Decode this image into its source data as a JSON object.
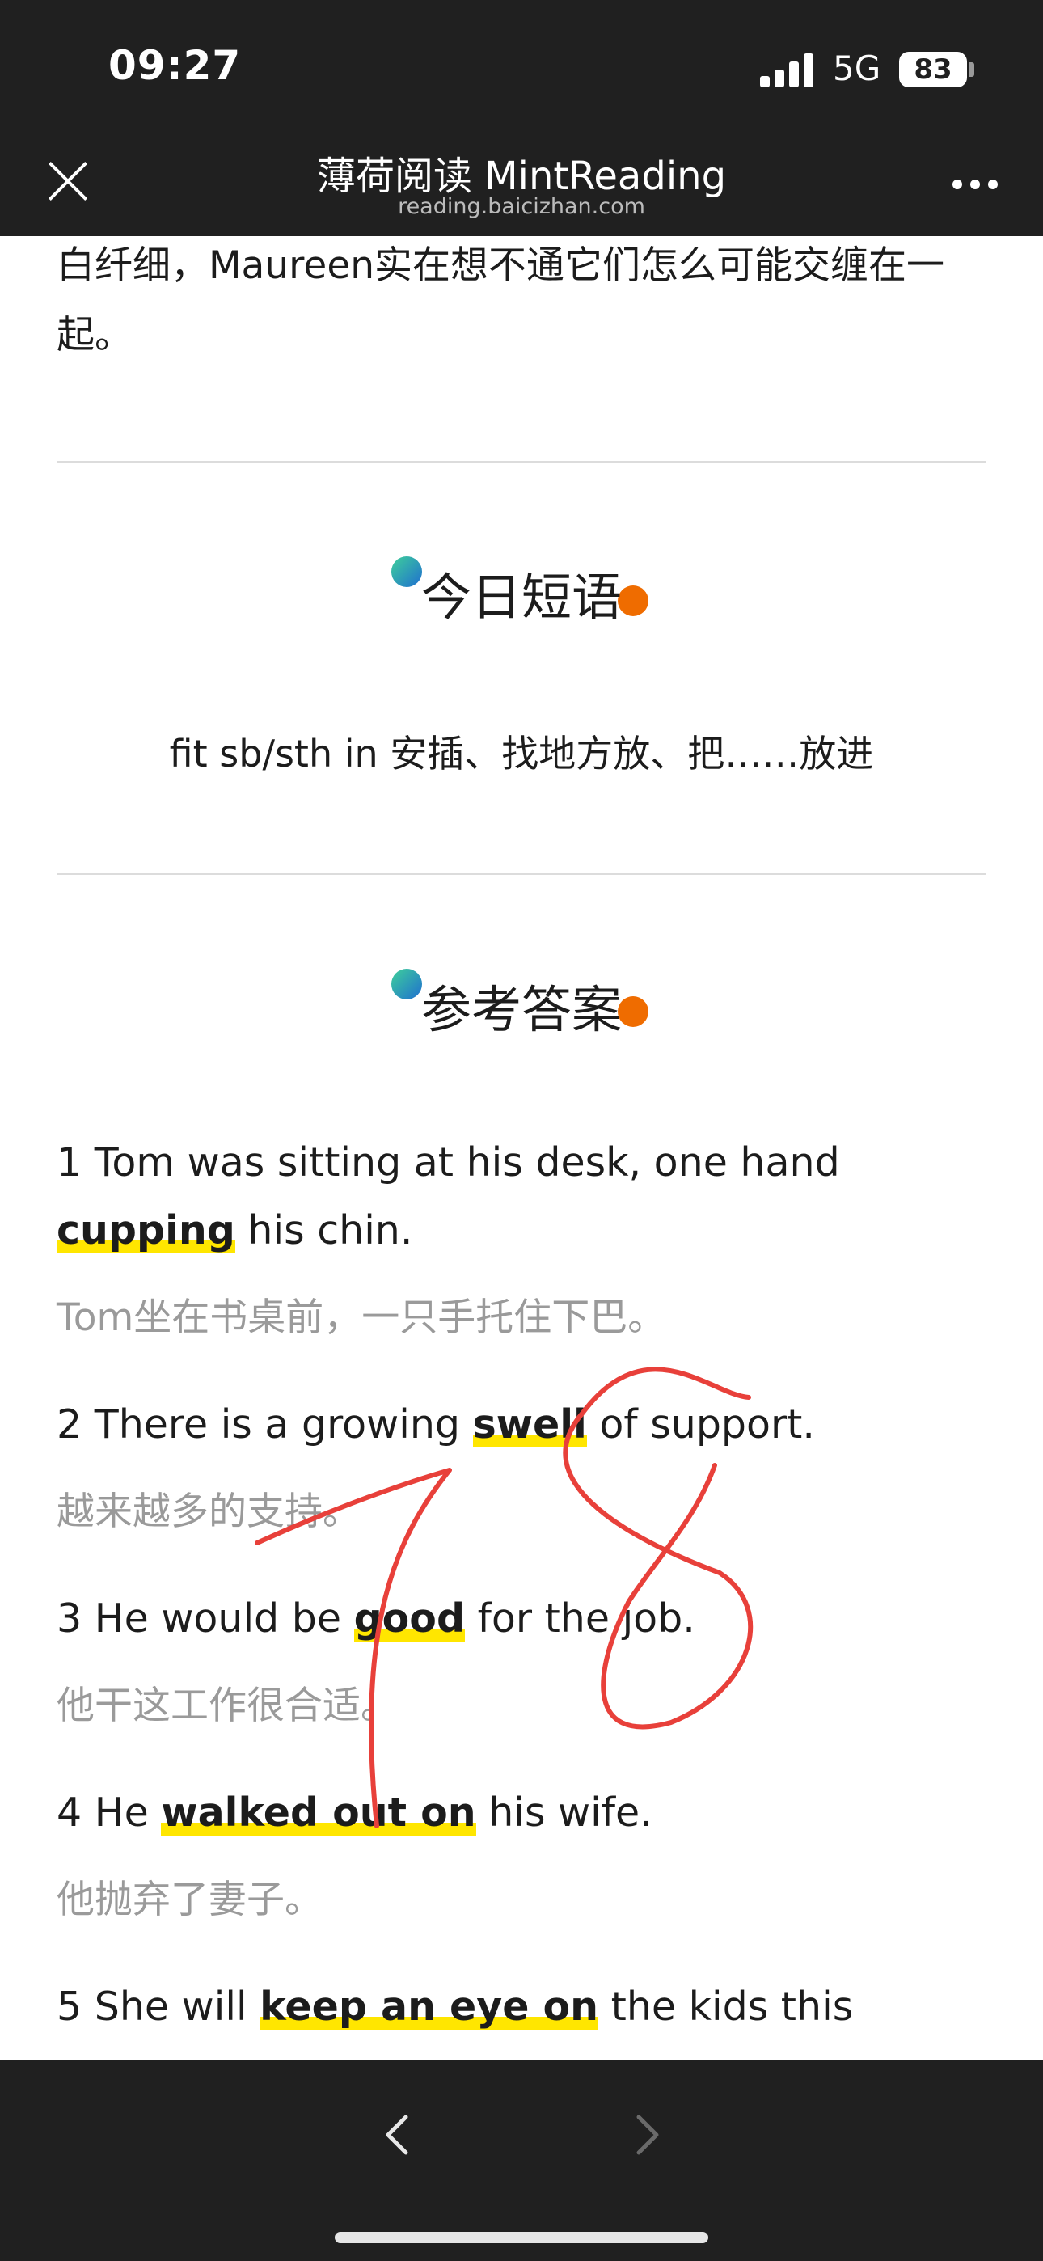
{
  "status_bar": {
    "time": "09:27",
    "network": "5G",
    "battery": "83"
  },
  "nav": {
    "title": "薄荷阅读 MintReading",
    "url": "reading.baicizhan.com"
  },
  "intro": {
    "text": "白纤细，Maureen实在想不通它们怎么可能交缠在一起。"
  },
  "phrase_section": {
    "title": "今日短语",
    "phrase": "fit sb/sth in 安插、找地方放、把……放进"
  },
  "answers_section": {
    "title": "参考答案",
    "items": [
      {
        "num": "1",
        "pre": "Tom was sitting at his desk, one hand ",
        "hl": "cupping",
        "post": " his chin.",
        "zh": "Tom坐在书桌前，一只手托住下巴。"
      },
      {
        "num": "2",
        "pre": "There is a growing ",
        "hl": "swell",
        "post": " of support.",
        "zh": "越来越多的支持。"
      },
      {
        "num": "3",
        "pre": "He would be ",
        "hl": "good",
        "post": " for the job.",
        "zh": "他干这工作很合适。"
      },
      {
        "num": "4",
        "pre": "He ",
        "hl": "walked out on",
        "post": " his wife.",
        "zh": "他抛弃了妻子。"
      },
      {
        "num": "5",
        "pre": "She will ",
        "hl": "keep an eye on",
        "post": " the kids this",
        "zh": ""
      }
    ]
  },
  "annotation": {
    "text": "78",
    "color": "#e8403a"
  },
  "colors": {
    "bar": "#202020",
    "highlight": "#ffe600",
    "translation": "#9a9a9a",
    "dot_orange": "#ef6c00"
  },
  "icons": [
    "close-icon",
    "more-icon",
    "back-arrow-icon",
    "forward-arrow-icon"
  ]
}
